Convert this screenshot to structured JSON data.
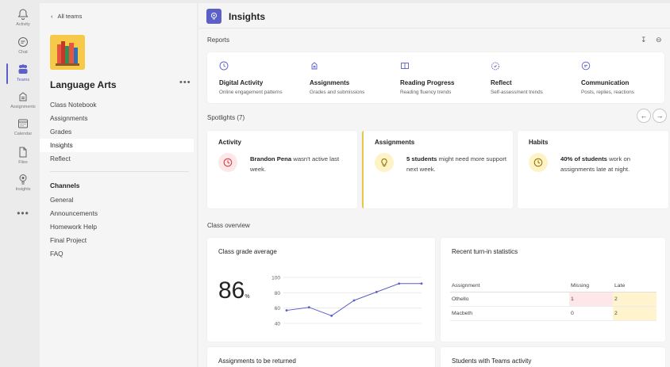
{
  "rail": {
    "items": [
      {
        "label": "Activity",
        "icon": "bell-icon"
      },
      {
        "label": "Chat",
        "icon": "chat-icon"
      },
      {
        "label": "Teams",
        "icon": "teams-icon"
      },
      {
        "label": "Assignments",
        "icon": "assignments-icon"
      },
      {
        "label": "Calendar",
        "icon": "calendar-icon"
      },
      {
        "label": "Files",
        "icon": "file-icon"
      },
      {
        "label": "Insights",
        "icon": "insights-icon"
      }
    ],
    "more": "•••"
  },
  "sidebar": {
    "back_label": "All teams",
    "class_name": "Language Arts",
    "more": "•••",
    "nav": [
      "Class Notebook",
      "Assignments",
      "Grades",
      "Insights",
      "Reflect"
    ],
    "active_nav": "Insights",
    "channels_heading": "Channels",
    "channels": [
      "General",
      "Announcements",
      "Homework Help",
      "Final Project",
      "FAQ"
    ]
  },
  "header": {
    "title": "Insights"
  },
  "reports": {
    "heading": "Reports",
    "items": [
      {
        "title": "Digital Activity",
        "subtitle": "Online engagement patterns",
        "icon": "clock-icon"
      },
      {
        "title": "Assignments",
        "subtitle": "Grades and submissions",
        "icon": "assignment-icon"
      },
      {
        "title": "Reading Progress",
        "subtitle": "Reading fluency trends",
        "icon": "book-icon"
      },
      {
        "title": "Reflect",
        "subtitle": "Self-assessment trends",
        "icon": "reflect-icon"
      },
      {
        "title": "Communication",
        "subtitle": "Posts, replies, reactions",
        "icon": "chat-bubble-icon"
      }
    ]
  },
  "spotlights": {
    "heading": "Spotlights (7)",
    "cards": [
      {
        "title": "Activity",
        "bold": "Brandon Pena",
        "text": " wasn't active last week.",
        "icon": "clock-icon",
        "color": "#fde7e9",
        "icon_color": "#d13438"
      },
      {
        "title": "Assignments",
        "bold": "5 students",
        "text": " might need more support next week.",
        "icon": "lightbulb-icon",
        "color": "#fdf3c4",
        "icon_color": "#8a6d00"
      },
      {
        "title": "Habits",
        "bold": "40% of students",
        "text": " work on assignments late at night.",
        "icon": "clock-icon",
        "color": "#fdf3c4",
        "icon_color": "#8a6d00"
      }
    ]
  },
  "class_overview": {
    "heading": "Class overview",
    "grade_card": {
      "title": "Class grade average",
      "value": "86",
      "unit": "%"
    },
    "turnin_card": {
      "title": "Recent turn-in statistics",
      "columns": [
        "Assignment",
        "Missing",
        "Late"
      ],
      "rows": [
        {
          "assignment": "Othello",
          "missing": "1",
          "late": "2"
        },
        {
          "assignment": "Macbeth",
          "missing": "0",
          "late": "2"
        }
      ]
    },
    "returned_card": {
      "title": "Assignments to be returned"
    },
    "teams_activity_card": {
      "title": "Students with Teams activity"
    }
  },
  "chart_data": {
    "type": "line",
    "title": "",
    "x": [
      1,
      2,
      3,
      4,
      5,
      6,
      7
    ],
    "y": [
      57,
      61,
      50,
      70,
      81,
      92,
      92
    ],
    "yticks": [
      100,
      80,
      60,
      40
    ],
    "ylim": [
      40,
      100
    ],
    "color": "#5b5fc7",
    "grid": true
  },
  "colors": {
    "accent": "#5b5fc7",
    "highlight_red": "#fde7e9",
    "highlight_yellow": "#fff4ce"
  }
}
